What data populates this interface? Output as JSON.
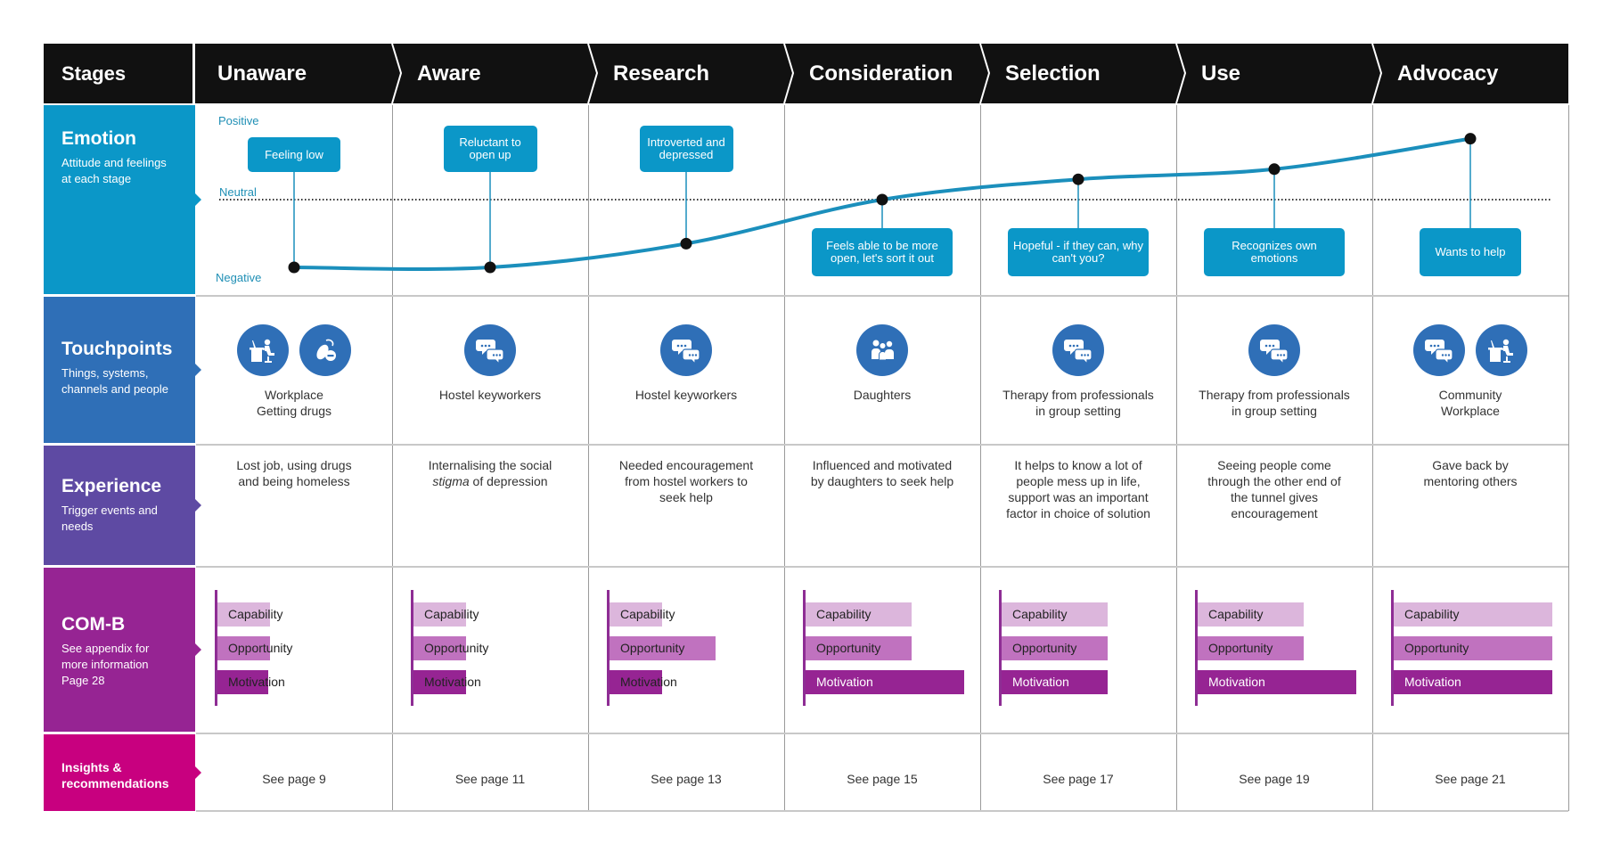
{
  "header": {
    "stages_label": "Stages",
    "stages": [
      "Unaware",
      "Aware",
      "Research",
      "Consideration",
      "Selection",
      "Use",
      "Advocacy"
    ]
  },
  "rows": {
    "emotion": {
      "title": "Emotion",
      "subtitle": "Attitude and feelings at each stage",
      "color": "#0b97c8"
    },
    "touchpoints": {
      "title": "Touchpoints",
      "subtitle": "Things, systems, channels and people",
      "color": "#2f6fb7"
    },
    "experience": {
      "title": "Experience",
      "subtitle": "Trigger events and needs",
      "color": "#5e4aa3"
    },
    "comb": {
      "title": "COM-B",
      "subtitle": "See appendix for more information Page 28",
      "color": "#962493"
    },
    "insights": {
      "title": "Insights & recommendations",
      "color": "#c8007f"
    }
  },
  "emotion": {
    "axis_labels": {
      "positive": "Positive",
      "neutral": "Neutral",
      "negative": "Negative"
    },
    "line_color": "#1b8fbc",
    "callouts": [
      {
        "stage": "Unaware",
        "text": "Feeling low",
        "position": "above"
      },
      {
        "stage": "Aware",
        "text": "Reluctant to open up",
        "position": "above"
      },
      {
        "stage": "Research",
        "text": "Introverted and depressed",
        "position": "above"
      },
      {
        "stage": "Consideration",
        "text": "Feels able to be more open, let's sort it out",
        "position": "below"
      },
      {
        "stage": "Selection",
        "text": "Hopeful - if they can, why can't you?",
        "position": "below"
      },
      {
        "stage": "Use",
        "text": "Recognizes own emotions",
        "position": "below"
      },
      {
        "stage": "Advocacy",
        "text": "Wants to help",
        "position": "below"
      }
    ]
  },
  "chart_data": {
    "type": "line",
    "title": "Emotion",
    "x": [
      "Unaware",
      "Aware",
      "Research",
      "Consideration",
      "Selection",
      "Use",
      "Advocacy"
    ],
    "values": [
      -1.0,
      -1.0,
      -0.65,
      0.0,
      0.3,
      0.45,
      0.9
    ],
    "ylabel": "Emotion",
    "ylim": [
      -1,
      1
    ],
    "ytick_labels": [
      "Negative",
      "Neutral",
      "Positive"
    ],
    "reference_line": {
      "value": 0,
      "label": "Neutral",
      "style": "dotted"
    }
  },
  "touchpoints": [
    {
      "icons": [
        "workplace-desk",
        "drugs-pill"
      ],
      "lines": [
        "Workplace",
        "Getting drugs"
      ]
    },
    {
      "icons": [
        "chat-bubbles"
      ],
      "lines": [
        "Hostel keyworkers"
      ]
    },
    {
      "icons": [
        "chat-bubbles"
      ],
      "lines": [
        "Hostel keyworkers"
      ]
    },
    {
      "icons": [
        "family-group"
      ],
      "lines": [
        "Daughters"
      ]
    },
    {
      "icons": [
        "chat-bubbles"
      ],
      "lines": [
        "Therapy from professionals",
        "in group setting"
      ]
    },
    {
      "icons": [
        "chat-bubbles"
      ],
      "lines": [
        "Therapy from professionals",
        "in group setting"
      ]
    },
    {
      "icons": [
        "chat-bubbles",
        "workplace-desk"
      ],
      "lines": [
        "Community",
        "Workplace"
      ]
    }
  ],
  "experience": [
    {
      "lines": [
        "Lost job, using drugs",
        "and being homeless"
      ]
    },
    {
      "lines": [
        "Internalising the social",
        "stigma of depression"
      ],
      "italic_word": "stigma"
    },
    {
      "lines": [
        "Needed encouragement",
        "from hostel workers to",
        "seek help"
      ]
    },
    {
      "lines": [
        "Influenced and motivated",
        "by daughters to seek help"
      ]
    },
    {
      "lines": [
        "It helps to know a lot of",
        "people mess up in life,",
        "support was an important",
        "factor in choice of solution"
      ]
    },
    {
      "lines": [
        "Seeing people come",
        "through the other end of",
        "the tunnel gives",
        "encouragement"
      ]
    },
    {
      "lines": [
        "Gave back by",
        "mentoring others"
      ]
    }
  ],
  "comb": {
    "labels": [
      "Capability",
      "Opportunity",
      "Motivation"
    ],
    "colors": [
      "#dcb6dc",
      "#c072bf",
      "#962493"
    ],
    "values_fraction": [
      [
        0.33,
        0.33,
        0.32
      ],
      [
        0.33,
        0.33,
        0.33
      ],
      [
        0.33,
        0.67,
        0.33
      ],
      [
        0.67,
        0.67,
        1.0
      ],
      [
        0.67,
        0.67,
        0.67
      ],
      [
        0.67,
        0.67,
        1.0
      ],
      [
        1.0,
        1.0,
        1.0
      ]
    ]
  },
  "insights": [
    "See page 9",
    "See page 11",
    "See page 13",
    "See page 15",
    "See page 17",
    "See page 19",
    "See page 21"
  ]
}
